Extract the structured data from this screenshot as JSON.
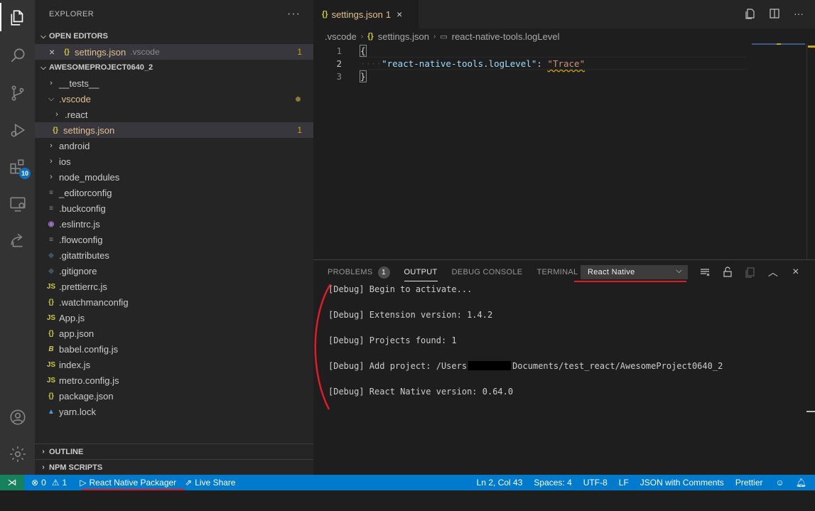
{
  "activity_bar": {
    "icons": [
      "explorer-icon",
      "search-icon",
      "source-control-icon",
      "run-debug-icon",
      "extensions-icon",
      "remote-explorer-icon",
      "live-share-icon",
      "accounts-icon",
      "manage-gear-icon"
    ],
    "extensions_badge": "10"
  },
  "sidebar": {
    "title": "EXPLORER",
    "more": "···",
    "open_editors": {
      "label": "OPEN EDITORS",
      "items": [
        {
          "name": "settings.json",
          "folder": ".vscode",
          "badge": "1"
        }
      ]
    },
    "project": {
      "label": "AWESOMEPROJECT0640_2",
      "tree": [
        {
          "label": "__tests__",
          "kind": "folder-collapsed"
        },
        {
          "label": ".vscode",
          "kind": "folder-expanded"
        },
        {
          "label": ".react",
          "kind": "subfolder-collapsed"
        },
        {
          "label": "settings.json",
          "kind": "file",
          "icon": "{}",
          "badge": "1"
        },
        {
          "label": "android",
          "kind": "folder-collapsed"
        },
        {
          "label": "ios",
          "kind": "folder-collapsed"
        },
        {
          "label": "node_modules",
          "kind": "folder-collapsed"
        },
        {
          "label": "_editorconfig",
          "icon": "≡"
        },
        {
          "label": ".buckconfig",
          "icon": "≡"
        },
        {
          "label": ".eslintrc.js",
          "icon": "◉"
        },
        {
          "label": ".flowconfig",
          "icon": "≡"
        },
        {
          "label": ".gitattributes",
          "icon": "◆"
        },
        {
          "label": ".gitignore",
          "icon": "◆"
        },
        {
          "label": ".prettierrc.js",
          "icon": "JS"
        },
        {
          "label": ".watchmanconfig",
          "icon": "{}"
        },
        {
          "label": "App.js",
          "icon": "JS"
        },
        {
          "label": "app.json",
          "icon": "{}"
        },
        {
          "label": "babel.config.js",
          "icon": "B"
        },
        {
          "label": "index.js",
          "icon": "JS"
        },
        {
          "label": "metro.config.js",
          "icon": "JS"
        },
        {
          "label": "package.json",
          "icon": "{}"
        },
        {
          "label": "yarn.lock",
          "icon": "▲"
        }
      ]
    },
    "outline_label": "OUTLINE",
    "npm_label": "NPM SCRIPTS"
  },
  "editor": {
    "tab": {
      "icon": "{}",
      "name": "settings.json",
      "problems": "1",
      "close": "×"
    },
    "breadcrumb": [
      ".vscode",
      "settings.json",
      "react-native-tools.logLevel"
    ],
    "lines": [
      {
        "num": "1",
        "text": "{"
      },
      {
        "num": "2",
        "key": "\"react-native-tools.logLevel\"",
        "colon": ": ",
        "value": "\"Trace\""
      },
      {
        "num": "3",
        "text": "}"
      }
    ]
  },
  "panel": {
    "tabs": [
      {
        "label": "PROBLEMS",
        "badge": "1"
      },
      {
        "label": "OUTPUT"
      },
      {
        "label": "DEBUG CONSOLE"
      },
      {
        "label": "TERMINAL"
      }
    ],
    "output_channel": "React Native",
    "output_lines": [
      "[Debug] Begin to activate...",
      "[Debug] Extension version: 1.4.2",
      "[Debug] Projects found: 1",
      "[Debug] Add project: /Users",
      "[Debug] React Native version: 0.64.0"
    ],
    "add_project_suffix": "Documents/test_react/AwesomeProject0640_2"
  },
  "statusbar": {
    "errors": "0",
    "warnings": "1",
    "packager": "React Native Packager",
    "live_share": "Live Share",
    "position": "Ln 2, Col 43",
    "spaces": "Spaces: 4",
    "encoding": "UTF-8",
    "eol": "LF",
    "language": "JSON with Comments",
    "formatter": "Prettier"
  },
  "colors": {
    "statusbar": "#007acc",
    "remote": "#16825d",
    "annotation_red": "#e31b23",
    "modified": "#e2c08d"
  }
}
